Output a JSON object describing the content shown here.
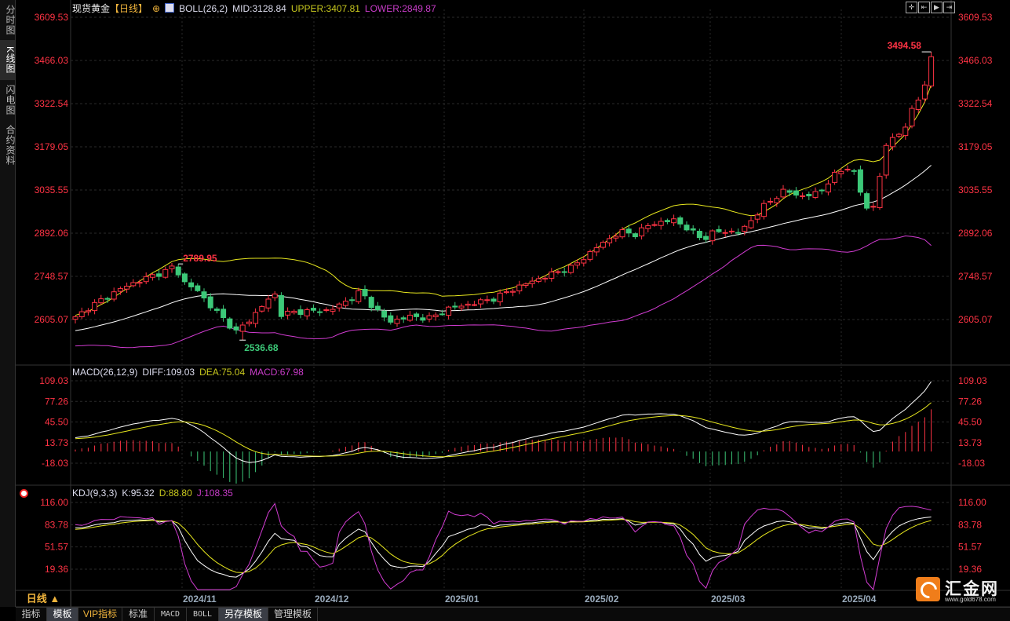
{
  "sidebar": {
    "tabs": [
      {
        "label": "分时图"
      },
      {
        "label": "K线图"
      },
      {
        "label": "闪电图"
      },
      {
        "label": "合约资料"
      }
    ]
  },
  "header": {
    "instrument": "现货黄金",
    "period": "【日线】",
    "boll": "BOLL(26,2)",
    "mid": "MID:3128.84",
    "upper": "UPPER:3407.81",
    "lower": "LOWER:2849.87"
  },
  "macd_header": {
    "name": "MACD(26,12,9)",
    "diff": "DIFF:109.03",
    "dea": "DEA:75.04",
    "macd": "MACD:67.98"
  },
  "kdj_header": {
    "name": "KDJ(9,3,3)",
    "k": "K:95.32",
    "d": "D:88.80",
    "j": "J:108.35"
  },
  "price_axis": [
    "3609.53",
    "3466.03",
    "3322.54",
    "3179.05",
    "3035.55",
    "2892.06",
    "2748.57",
    "2605.07"
  ],
  "macd_axis": [
    "109.03",
    "77.26",
    "45.50",
    "13.73",
    "-18.03"
  ],
  "kdj_axis": [
    "116.00",
    "83.78",
    "51.57",
    "19.36"
  ],
  "annotations": {
    "high1": "2789.95",
    "low1": "2536.68",
    "high2": "3494.58"
  },
  "dates": [
    "2024/11",
    "2024/12",
    "2025/01",
    "2025/02",
    "2025/03",
    "2025/04"
  ],
  "period_selector": "日线 ▲",
  "bottom_tabs": [
    "指标",
    "模板",
    "VIP指标",
    "标准",
    "MACD",
    "BOLL",
    "另存模板",
    "管理模板"
  ],
  "logo": {
    "name": "汇金网",
    "url": "www.gold678.com"
  },
  "colors": {
    "up": "#ff3344",
    "down": "#3cc878",
    "mid": "#ffffff",
    "upper": "#e8e81e",
    "lower": "#d23cd2",
    "axis": "#ff3344"
  },
  "chart_data": {
    "type": "candlestick",
    "price_range": [
      2536.68,
      3609.53
    ],
    "candle_count": 134,
    "close_anchors": [
      [
        0,
        2610
      ],
      [
        2,
        2644
      ],
      [
        7,
        2707
      ],
      [
        10,
        2735
      ],
      [
        14,
        2766
      ],
      [
        15.5,
        2785
      ],
      [
        16.5,
        2735
      ],
      [
        19,
        2700
      ],
      [
        20.5,
        2662
      ],
      [
        23.5,
        2597
      ],
      [
        25,
        2565
      ],
      [
        27,
        2602
      ],
      [
        29.5,
        2662
      ],
      [
        31,
        2688
      ],
      [
        32,
        2623
      ],
      [
        34.5,
        2631
      ],
      [
        39.5,
        2636
      ],
      [
        42.5,
        2670
      ],
      [
        44.4,
        2700
      ],
      [
        45.6,
        2662
      ],
      [
        48.7,
        2597
      ],
      [
        51.7,
        2615
      ],
      [
        55.4,
        2610
      ],
      [
        57.8,
        2641
      ],
      [
        61.5,
        2657
      ],
      [
        65,
        2675
      ],
      [
        68.8,
        2714
      ],
      [
        73.7,
        2754
      ],
      [
        77.3,
        2780
      ],
      [
        81,
        2845
      ],
      [
        84.6,
        2897
      ],
      [
        87,
        2889
      ],
      [
        89.5,
        2923
      ],
      [
        93,
        2936
      ],
      [
        95,
        2910
      ],
      [
        97.4,
        2871
      ],
      [
        99.3,
        2897
      ],
      [
        103.5,
        2897
      ],
      [
        106.6,
        2975
      ],
      [
        110.2,
        3035
      ],
      [
        112.7,
        3014
      ],
      [
        115.7,
        3027
      ],
      [
        117.6,
        3080
      ],
      [
        120.6,
        3119
      ],
      [
        121.8,
        3040
      ],
      [
        123,
        2975
      ],
      [
        124.3,
        2983
      ],
      [
        125.5,
        3158
      ],
      [
        127.3,
        3223
      ],
      [
        129.1,
        3236
      ],
      [
        130.4,
        3340
      ],
      [
        131.6,
        3340
      ],
      [
        133,
        3480
      ]
    ],
    "marked_high": 2789.95,
    "marked_low": 2536.68,
    "last_high": 3494.58
  }
}
